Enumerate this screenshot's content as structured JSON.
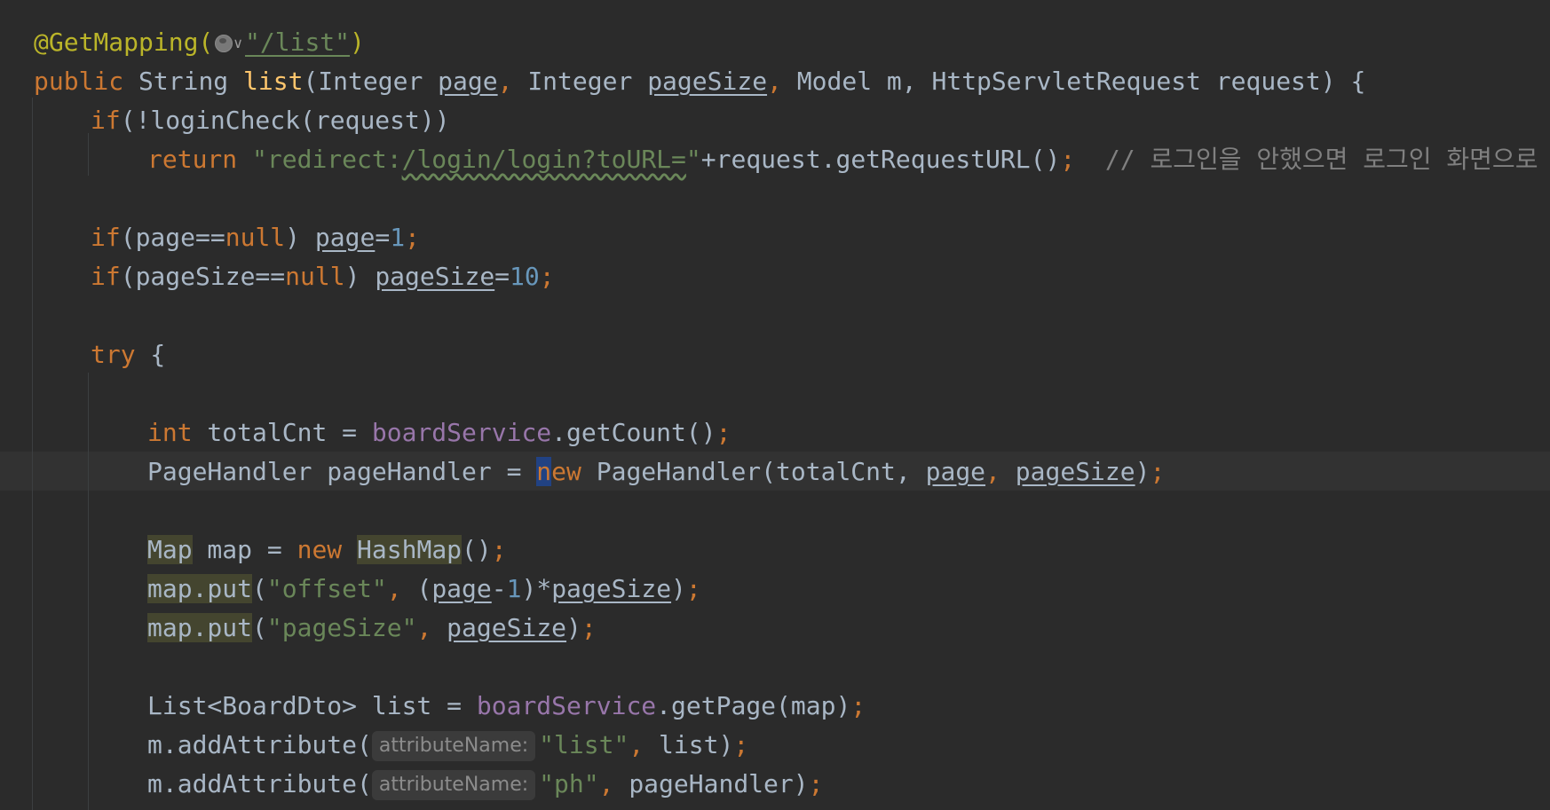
{
  "editor": {
    "annotation": "@GetMapping(",
    "mapping_path": "\"/list\"",
    "chevron": "v",
    "l1_close": ")",
    "l2": {
      "kw_public": "public",
      "type": " String ",
      "method": "list",
      "open": "(Integer ",
      "p_page": "page",
      "comma1": ", ",
      "type2": "Integer ",
      "p_pageSize": "pageSize",
      "comma2": ", ",
      "rest": "Model m, HttpServletRequest request) {"
    },
    "l3": {
      "kw": "if",
      "rest": "(!loginCheck(request))"
    },
    "l4": {
      "kw": "return",
      "str_a": "\"redirect:",
      "str_b": "/login/login?toURL=",
      "str_c": "\"",
      "rest": "+request.getRequestURL()",
      "semi": ";",
      "comment": "  // 로그인을 안했으면 로그인 화면으로 이동"
    },
    "l6": {
      "kw": "if",
      "cond": "(page==",
      "nul": "null",
      "close": ") ",
      "var": "page",
      "eq": "=",
      "num": "1",
      "semi": ";"
    },
    "l7": {
      "kw": "if",
      "cond": "(pageSize==",
      "nul": "null",
      "close": ") ",
      "var": "pageSize",
      "eq": "=",
      "num": "10",
      "semi": ";"
    },
    "l9": {
      "kw": "try",
      "rest": " {"
    },
    "l11": {
      "kw": "int",
      "mid": " totalCnt = ",
      "field": "boardService",
      "rest": ".getCount()",
      "semi": ";"
    },
    "l12": {
      "lhs": "PageHandler pageHandler = ",
      "kw_n": "n",
      "kw_ew": "ew",
      "type": " PageHandler(totalCnt, ",
      "a1": "page",
      "comma": ", ",
      "a2": "pageSize",
      "close": ")",
      "semi": ";"
    },
    "l14": {
      "t1": "Map",
      "mid": " map = ",
      "kw": "new",
      "sp": " ",
      "t2": "HashMap",
      "rest": "()",
      "semi": ";"
    },
    "l15": {
      "call": "map.put",
      "open": "(",
      "str": "\"offset\"",
      "comma": ", ",
      "p": "(",
      "v1": "page",
      "minus": "-",
      "n1": "1",
      "mul": ")*",
      "v2": "pageSize",
      "close": ")",
      "semi": ";"
    },
    "l16": {
      "call": "map.put",
      "open": "(",
      "str": "\"pageSize\"",
      "comma": ", ",
      "v": "pageSize",
      "close": ")",
      "semi": ";"
    },
    "l18": {
      "lhs": "List<BoardDto> list = ",
      "field": "boardService",
      "rest": ".getPage(map)",
      "semi": ";"
    },
    "l19": {
      "call": "m.addAttribute(",
      "hint": "attributeName:",
      "str": "\"list\"",
      "comma": ", ",
      "rest": "list)",
      "semi": ";"
    },
    "l20": {
      "call": "m.addAttribute(",
      "hint": "attributeName:",
      "str": "\"ph\"",
      "comma": ", ",
      "rest": "pageHandler)",
      "semi": ";"
    }
  }
}
